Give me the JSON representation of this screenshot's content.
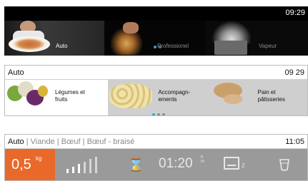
{
  "screen1": {
    "time": "09:29",
    "tiles": [
      {
        "label": "Auto",
        "active": true
      },
      {
        "label": "Professionel",
        "active": false
      },
      {
        "label": "Vapeur",
        "active": false
      }
    ],
    "pager": {
      "pages": 2,
      "current": 1
    }
  },
  "screen2": {
    "title": "Auto",
    "time": "09 29",
    "tiles": [
      {
        "label_line1": "Légumes et",
        "label_line2": "fruits"
      },
      {
        "label_line1": "Accompagn-",
        "label_line2": "ements"
      },
      {
        "label_line1": "Pain et",
        "label_line2": "pâtisseries"
      }
    ],
    "pager": {
      "pages": 3,
      "current": 1
    }
  },
  "screen3": {
    "breadcrumb": [
      "Auto",
      "Viande",
      "Bœuf",
      "Bœuf - braisé"
    ],
    "separator": " | ",
    "time": "11:05",
    "weight": {
      "value": "0,5",
      "unit": "kg"
    },
    "doneness": {
      "level": 3,
      "max": 6
    },
    "timer": {
      "value": "01:20",
      "unit_top": "h",
      "unit_bottom": "m"
    },
    "shelf": {
      "level": "2"
    },
    "colors": {
      "accent": "#e8692a",
      "panel": "#9a9a9a",
      "pager_active": "#2aa7c9"
    }
  }
}
